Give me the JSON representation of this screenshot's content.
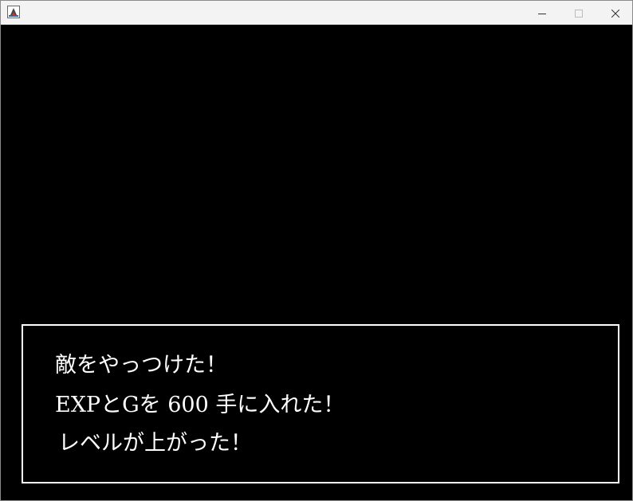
{
  "window": {
    "title": "",
    "app_icon": "java-app-icon",
    "controls": {
      "minimize": "minimize-icon",
      "maximize": "maximize-icon",
      "close": "close-icon"
    }
  },
  "game": {
    "background_color": "#000000",
    "message_box": {
      "border_color": "#ffffff",
      "text_color": "#ffffff",
      "lines": [
        "敵をやっつけた！",
        "EXPとGを 600 手に入れた！",
        "レベルが上がった！"
      ]
    }
  }
}
